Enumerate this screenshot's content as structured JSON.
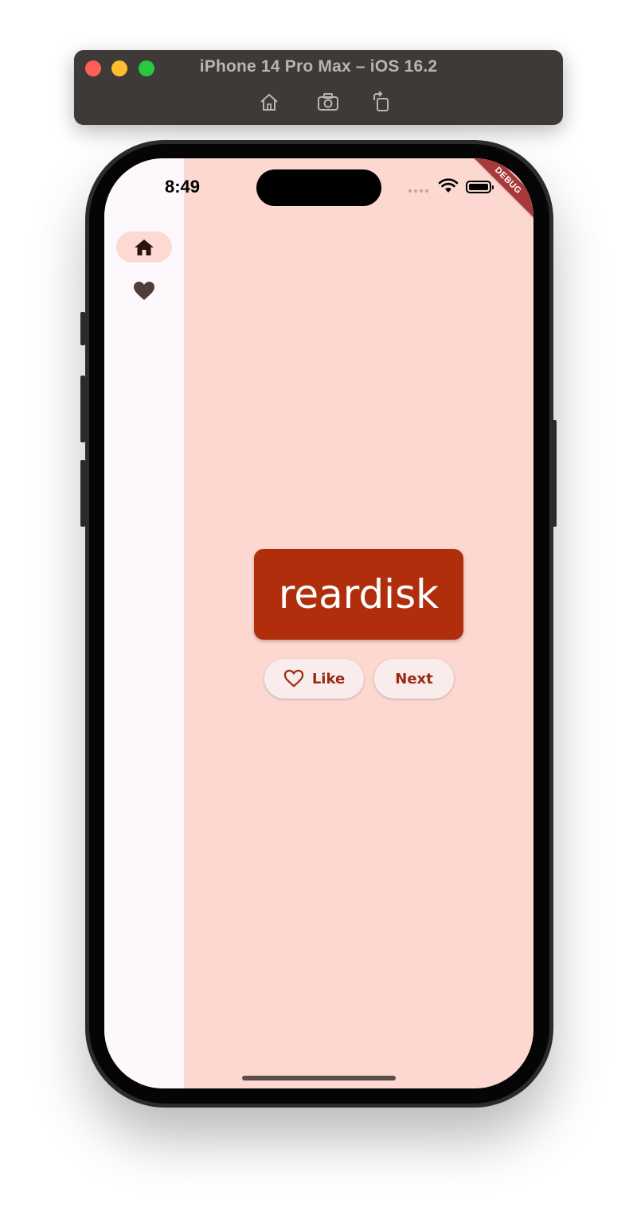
{
  "simulator": {
    "title": "iPhone 14 Pro Max – iOS 16.2",
    "tools": [
      {
        "icon": "home-icon"
      },
      {
        "icon": "screenshot-icon"
      },
      {
        "icon": "rotate-icon"
      }
    ]
  },
  "status_bar": {
    "time": "8:49"
  },
  "debug_banner": "DEBUG",
  "nav_rail": {
    "items": [
      {
        "icon": "home-icon",
        "selected": true
      },
      {
        "icon": "favorite-icon",
        "selected": false
      }
    ]
  },
  "main": {
    "word": "reardisk",
    "like_label": "Like",
    "next_label": "Next"
  },
  "colors": {
    "background": "#fcd8d0",
    "rail": "#fdf8fb",
    "card": "#b02e0c",
    "button_text": "#9a2b12"
  }
}
